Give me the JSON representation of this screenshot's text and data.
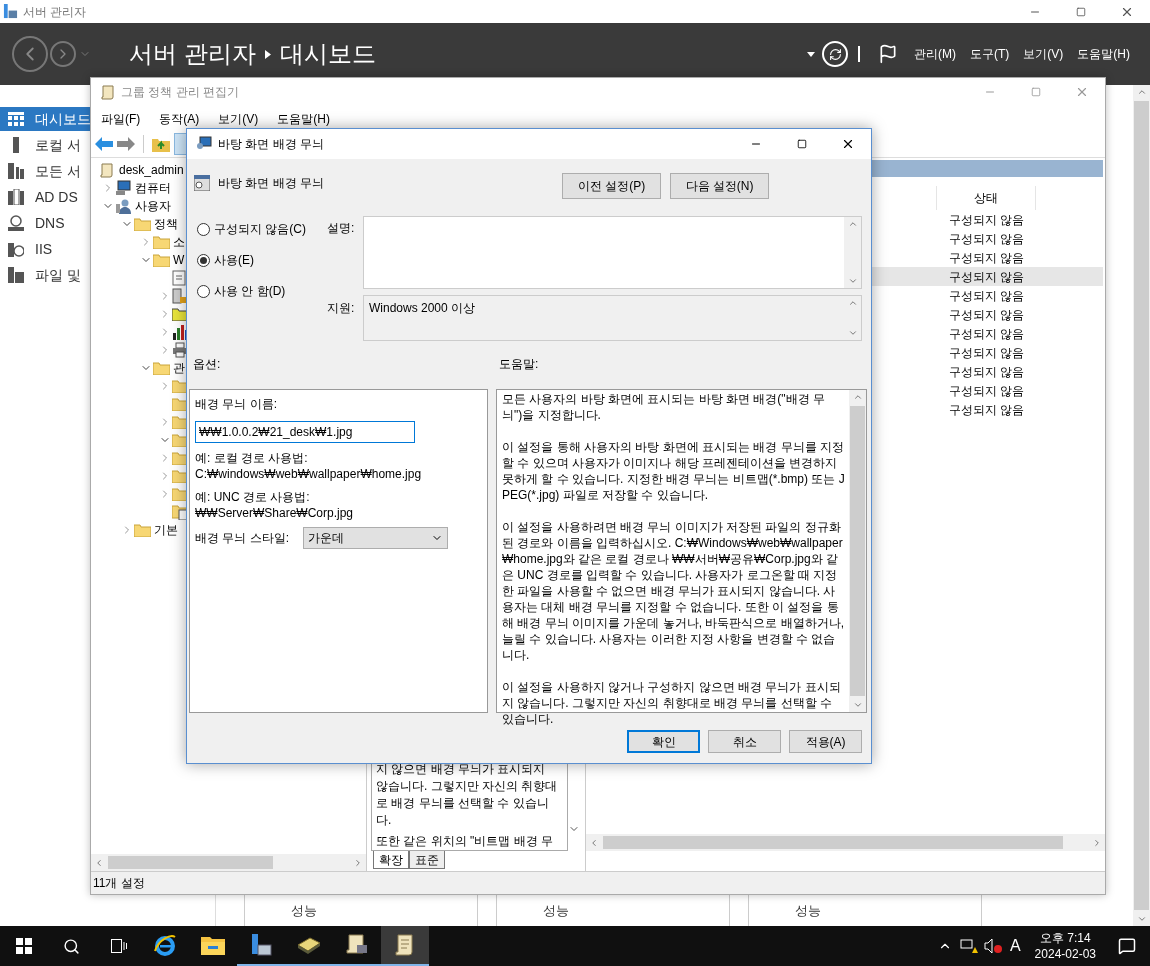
{
  "server_manager": {
    "title": "서버 관리자",
    "breadcrumb": [
      "서버 관리자",
      "대시보드"
    ],
    "menu": [
      "관리(M)",
      "도구(T)",
      "보기(V)",
      "도움말(H)"
    ],
    "sidebar": [
      {
        "label": "대시보드",
        "kind": "dashboard",
        "selected": true
      },
      {
        "label": "로컬 서",
        "kind": "server",
        "selected": false
      },
      {
        "label": "모든 서",
        "kind": "servers",
        "selected": false
      },
      {
        "label": "AD DS",
        "kind": "adds",
        "selected": false
      },
      {
        "label": "DNS",
        "kind": "dns",
        "selected": false
      },
      {
        "label": "IIS",
        "kind": "iis",
        "selected": false
      },
      {
        "label": "파일 및",
        "kind": "files",
        "selected": false
      }
    ],
    "tiles": [
      "성능",
      "성능",
      "성능"
    ]
  },
  "gpo_editor": {
    "title": "그룹 정책 관리 편집기",
    "menu": [
      "파일(F)",
      "동작(A)",
      "보기(V)",
      "도움말(H)"
    ],
    "tree": {
      "label": "desk_admin",
      "kind": "root",
      "children": [
        {
          "label": "컴퓨터",
          "kind": "computer",
          "expanded": false
        },
        {
          "label": "사용자",
          "kind": "user",
          "expanded": true,
          "children": [
            {
              "label": "정책",
              "kind": "folder",
              "expanded": true,
              "children": [
                {
                  "label": "소",
                  "kind": "folder",
                  "expanded": false
                },
                {
                  "label": "W",
                  "kind": "folder",
                  "expanded": true,
                  "children": [
                    {
                      "kind": "script"
                    },
                    {
                      "kind": "lock",
                      "expanded": false
                    },
                    {
                      "kind": "folder-grid",
                      "expanded": false
                    },
                    {
                      "kind": "chart",
                      "expanded": false
                    },
                    {
                      "kind": "printer",
                      "expanded": false
                    }
                  ]
                },
                {
                  "label": "관",
                  "kind": "folder",
                  "expanded": true,
                  "children": [
                    {
                      "kind": "folder",
                      "expanded": false
                    },
                    {
                      "kind": "folder"
                    },
                    {
                      "kind": "folder",
                      "expanded": false
                    },
                    {
                      "kind": "folder",
                      "expanded": true
                    },
                    {
                      "kind": "folder",
                      "expanded": false
                    },
                    {
                      "kind": "folder",
                      "expanded": false
                    },
                    {
                      "kind": "folder",
                      "expanded": false
                    },
                    {
                      "kind": "doc"
                    }
                  ]
                }
              ]
            },
            {
              "label": "기본",
              "kind": "folder",
              "expanded": false
            }
          ]
        }
      ]
    },
    "description_lines": [
      "지 않으면 배경 무늬가 표시되지",
      "않습니다. 그렇지만 자신의 취향대",
      "로 배경 무늬를 선택할 수 있습니",
      "다.",
      "또한 같은 위치의 \"비트맵 배경 무"
    ],
    "tabs": [
      {
        "label": "확장",
        "selected": true
      },
      {
        "label": "표준",
        "selected": false
      }
    ],
    "list": {
      "columns": [
        "상태"
      ],
      "rows": [
        {
          "status": "구성되지 않음",
          "selected": false
        },
        {
          "status": "구성되지 않음",
          "selected": false
        },
        {
          "status": "구성되지 않음",
          "selected": false
        },
        {
          "status": "구성되지 않음",
          "selected": true
        },
        {
          "status": "구성되지 않음",
          "selected": false
        },
        {
          "status": "구성되지 않음",
          "selected": false
        },
        {
          "status": "구성되지 않음",
          "selected": false
        },
        {
          "status": "구성되지 않음",
          "selected": false
        },
        {
          "status": "구성되지 않음",
          "selected": false
        },
        {
          "status": "구성되지 않음",
          "selected": false
        },
        {
          "status": "구성되지 않음",
          "selected": false
        }
      ]
    },
    "status_bar": "11개 설정"
  },
  "dialog": {
    "title": "바탕 화면 배경 무늬",
    "heading": "바탕 화면 배경 무늬",
    "nav_buttons": [
      "이전 설정(P)",
      "다음 설정(N)"
    ],
    "radios": [
      {
        "label": "구성되지 않음(C)",
        "selected": false
      },
      {
        "label": "사용(E)",
        "selected": true
      },
      {
        "label": "사용 안 함(D)",
        "selected": false
      }
    ],
    "comment_label": "설명:",
    "supported_label": "지원:",
    "supported": "Windows 2000 이상",
    "options_label": "옵션:",
    "help_label": "도움말:",
    "options": {
      "name_label": "배경 무늬 이름:",
      "name_value": "₩₩1.0.0.2₩21_desk₩1.jpg",
      "examples": [
        [
          "예: 로컬 경로 사용법:",
          "C:₩windows₩web₩wallpaper₩home.jpg"
        ],
        [
          "예: UNC 경로 사용법:",
          "₩₩Server₩Share₩Corp.jpg"
        ]
      ],
      "style_label": "배경 무늬 스타일:",
      "style_value": "가운데"
    },
    "help": [
      "모든 사용자의 바탕 화면에 표시되는 바탕 화면 배경(\"배경 무늬\")을 지정합니다.",
      "이 설정을 통해 사용자의 바탕 화면에 표시되는 배경 무늬를 지정할 수 있으며 사용자가 이미지나 해당 프레젠테이션을 변경하지 못하게 할 수 있습니다. 지정한 배경 무늬는 비트맵(*.bmp) 또는 JPEG(*.jpg) 파일로 저장할 수 있습니다.",
      "이 설정을 사용하려면 배경 무늬 이미지가 저장된 파일의 정규화된 경로와 이름을 입력하십시오. C:₩Windows₩web₩wallpaper₩home.jpg와 같은 로컬 경로나 ₩₩서버₩공유₩Corp.jpg와 같은 UNC 경로를 입력할 수 있습니다. 사용자가 로그온할 때 지정한 파일을 사용할 수 없으면 배경 무늬가 표시되지 않습니다. 사용자는 대체 배경 무늬를 지정할 수 없습니다. 또한 이 설정을 통해 배경 무늬 이미지를 가운데 놓거나, 바둑판식으로 배열하거나, 늘릴 수 있습니다. 사용자는 이러한 지정 사항을 변경할 수 없습니다.",
      "이 설정을 사용하지 않거나 구성하지 않으면 배경 무늬가 표시되지 않습니다. 그렇지만 자신의 취향대로 배경 무늬를 선택할 수 있습니다."
    ],
    "buttons": [
      {
        "label": "확인",
        "kind": "default"
      },
      {
        "label": "취소",
        "kind": "normal"
      },
      {
        "label": "적용(A)",
        "kind": "normal"
      }
    ]
  },
  "taskbar": {
    "apps": [
      {
        "kind": "ie",
        "running": false,
        "active": false
      },
      {
        "kind": "explorer",
        "running": false,
        "active": false
      },
      {
        "kind": "server-manager",
        "running": true,
        "active": false
      },
      {
        "kind": "book",
        "running": true,
        "active": false
      },
      {
        "kind": "scroll-tool",
        "running": true,
        "active": false
      },
      {
        "kind": "scroll",
        "running": true,
        "active": true
      }
    ],
    "ime": "A",
    "time": "오후 7:14",
    "date": "2024-02-03"
  }
}
